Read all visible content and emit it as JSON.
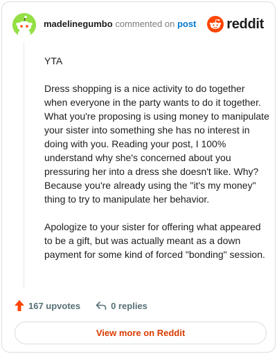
{
  "header": {
    "username": "madelinegumbo",
    "action_text": "commented on",
    "post_link": "post",
    "brand": "reddit"
  },
  "comment": {
    "paragraphs": [
      "YTA",
      "Dress shopping is a nice activity to do together when everyone in the party wants to do it together. What you're proposing is using money to manipulate your sister into something she has no interest in doing with you. Reading your post, I 100% understand why she's concerned about you pressuring her into a dress she doesn't like. Why? Because you're already using the \"it's my money\" thing to try to manipulate her behavior.",
      "Apologize to your sister for offering what appeared to be a gift, but was actually meant as a down payment for some kind of forced \"bonding\" session."
    ]
  },
  "footer": {
    "upvotes": "167 upvotes",
    "replies": "0 replies",
    "view_more": "View more on Reddit"
  },
  "colors": {
    "brand": "#ff4500",
    "link": "#0079d3",
    "avatar_bg": "#94e044",
    "cta": "#d93a00"
  }
}
